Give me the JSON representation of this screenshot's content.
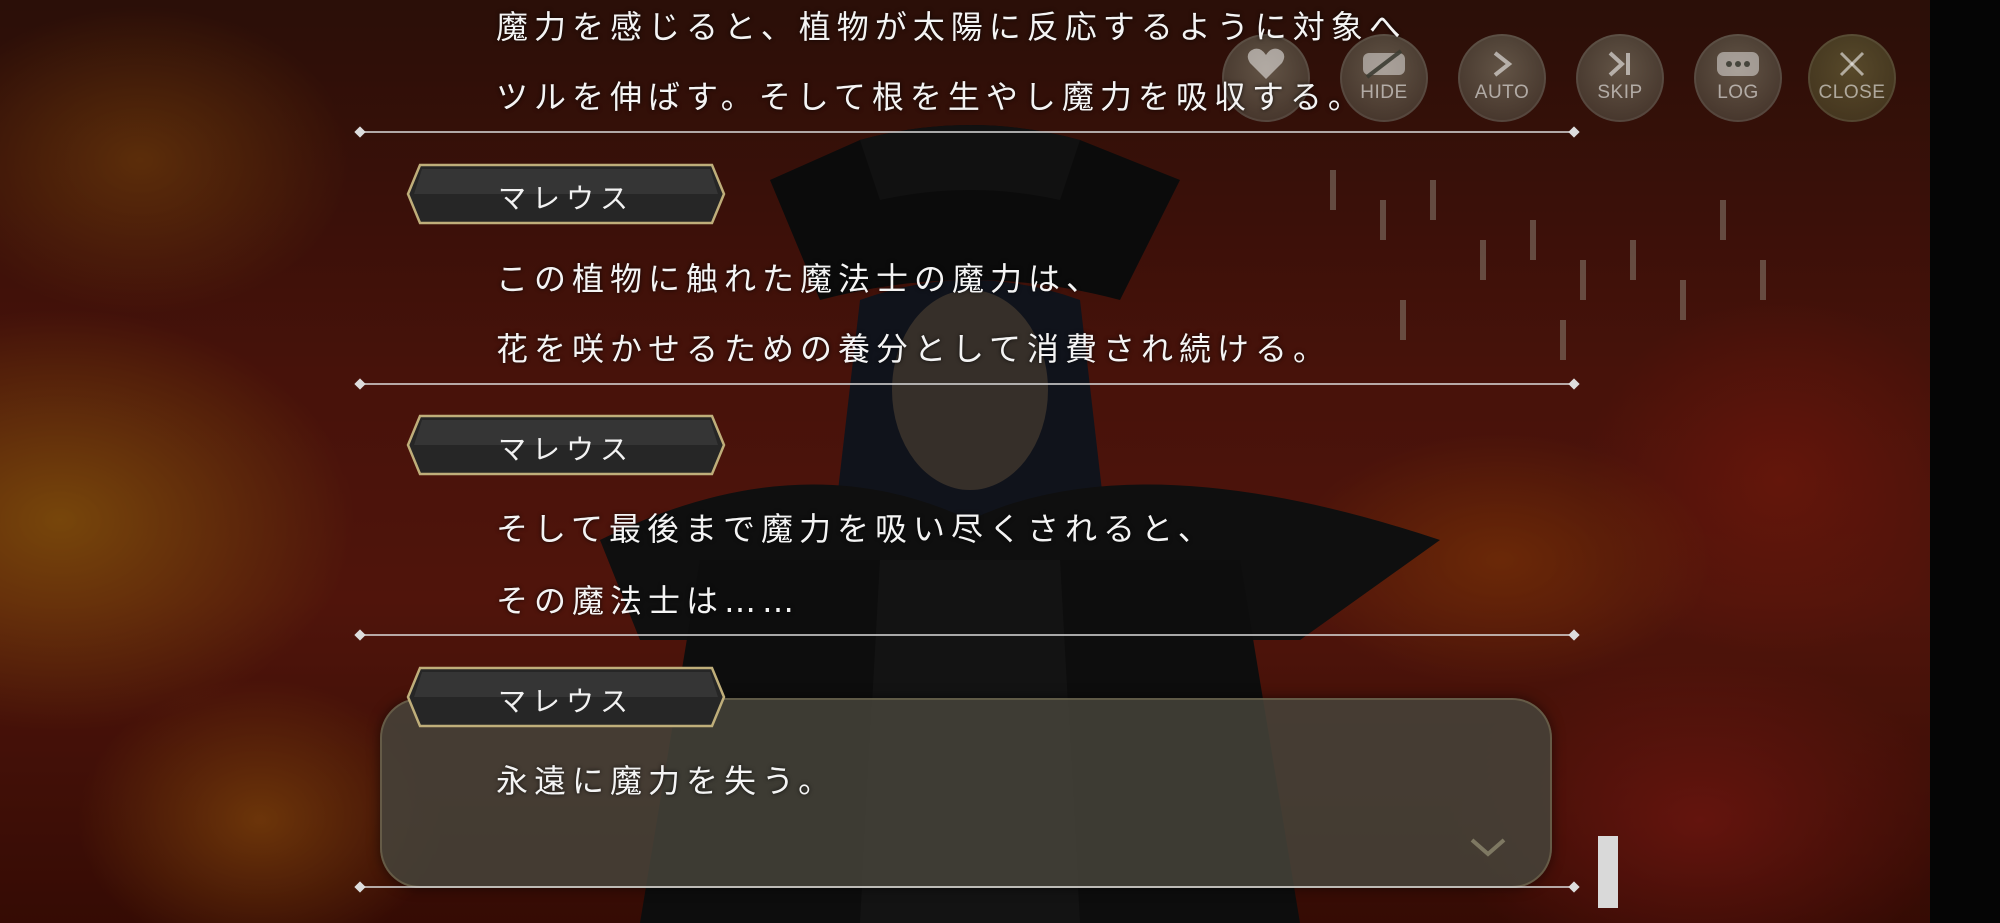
{
  "controls": [
    {
      "key": "heart",
      "label": "",
      "icon": "heart-icon"
    },
    {
      "key": "hide",
      "label": "HIDE",
      "icon": "hide-icon"
    },
    {
      "key": "auto",
      "label": "AUTO",
      "icon": "play-arrow-icon"
    },
    {
      "key": "skip",
      "label": "SKIP",
      "icon": "skip-icon"
    },
    {
      "key": "log",
      "label": "LOG",
      "icon": "log-bubble-icon"
    },
    {
      "key": "close",
      "label": "CLOSE",
      "icon": "close-icon"
    }
  ],
  "log": {
    "entry0": {
      "lines": [
        "魔力を感じると、植物が太陽に反応するように対象へ",
        "ツルを伸ばす。そして根を生やし魔力を吸収する。"
      ]
    },
    "entry1": {
      "speaker": "マレウス",
      "lines": [
        "この植物に触れた魔法士の魔力は、",
        "花を咲かせるための養分として消費され続ける。"
      ]
    },
    "entry2": {
      "speaker": "マレウス",
      "lines": [
        "そして最後まで魔力を吸い尽くされると、",
        "その魔法士は……"
      ]
    },
    "current": {
      "speaker": "マレウス",
      "lines": [
        "永遠に魔力を失う。"
      ]
    }
  },
  "colors": {
    "plate_border": "#bfae7a",
    "plate_fill": "#2a2a2a",
    "text": "#f4f4f4"
  }
}
